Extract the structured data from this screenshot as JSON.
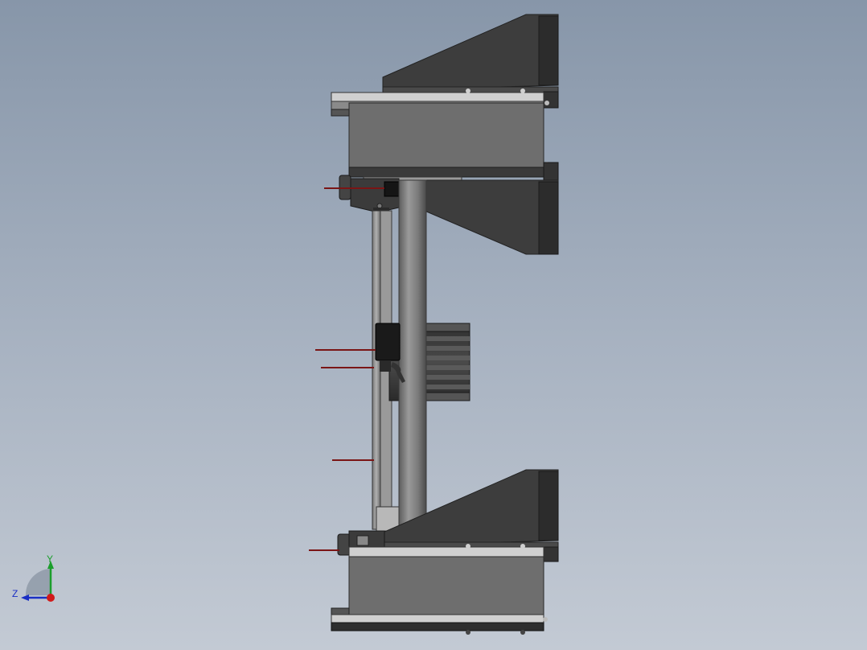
{
  "window": {
    "title": ""
  },
  "view": {
    "background_top": "#8796a9",
    "background_bottom": "#c3cad4",
    "model_body_color": "#6e6e6e",
    "model_dark_color": "#3a3a3a",
    "rod_color": "#8a8a8a",
    "wire_color": "#7a1515"
  },
  "triad": {
    "y_label": "Y",
    "z_label": "Z",
    "y_color": "#1b9e2c",
    "z_color": "#1a2fc4",
    "x_color": "#d11a1a"
  }
}
